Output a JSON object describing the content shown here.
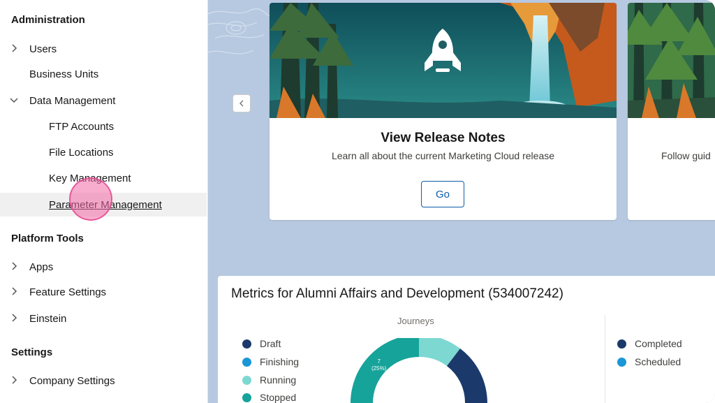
{
  "sidebar": {
    "sections": [
      {
        "title": "Administration"
      },
      {
        "title": "Platform Tools"
      },
      {
        "title": "Settings"
      }
    ],
    "items": {
      "users": "Users",
      "business_units": "Business Units",
      "data_management": "Data Management",
      "ftp_accounts": "FTP Accounts",
      "file_locations": "File Locations",
      "key_management": "Key Management",
      "parameter_management": "Parameter Management",
      "apps": "Apps",
      "feature_settings": "Feature Settings",
      "einstein": "Einstein",
      "company_settings": "Company Settings"
    },
    "active_item": "Parameter Management"
  },
  "carousel": {
    "cards": [
      {
        "title": "View Release Notes",
        "subtitle": "Learn all about the current Marketing Cloud release",
        "button": "Go",
        "icon": "rocket-icon"
      },
      {
        "subtitle": "Follow guid"
      }
    ]
  },
  "metrics": {
    "title": "Metrics for Alumni Affairs and Development (534007242)",
    "journeys": {
      "label": "Journeys",
      "legend": [
        {
          "name": "Draft",
          "color": "#1b3a6b"
        },
        {
          "name": "Finishing",
          "color": "#1b96d6"
        },
        {
          "name": "Running",
          "color": "#7dd8d2"
        },
        {
          "name": "Stopped",
          "color": "#16a39a"
        }
      ],
      "donut_label_value": "7",
      "donut_label_pct": "(25%)"
    },
    "right_legend": [
      {
        "name": "Completed",
        "color": "#1b3a6b"
      },
      {
        "name": "Scheduled",
        "color": "#1b96d6"
      }
    ]
  },
  "colors": {
    "brand_blue": "#0b5cab",
    "main_background": "#b7c9e0"
  }
}
